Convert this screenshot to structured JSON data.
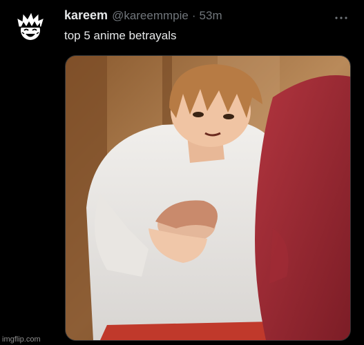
{
  "tweet": {
    "display_name": "kareem",
    "handle": "@kareemmpie",
    "separator": "·",
    "timestamp": "53m",
    "text": "top 5 anime betrayals"
  },
  "icons": {
    "avatar": "cartoon-face-avatar",
    "more": "more-dots-icon"
  },
  "media": {
    "description_kind": "anime-screenshot-image"
  },
  "watermark": {
    "text": "imgflip.com"
  },
  "colors": {
    "background": "#000000",
    "primary_text": "#e7e9ea",
    "secondary_text": "#71767b",
    "border": "#2f3336"
  }
}
